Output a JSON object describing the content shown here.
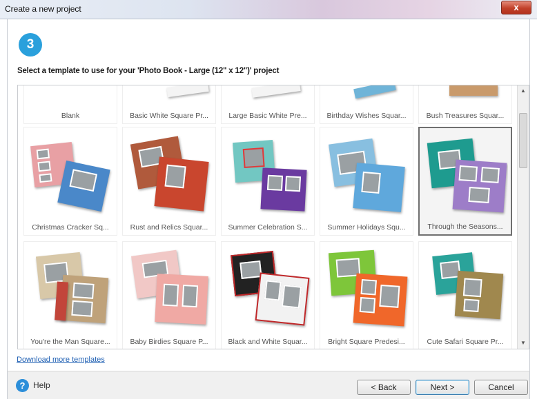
{
  "window": {
    "title": "Create a new project",
    "close_label": "x"
  },
  "step": {
    "number": "3"
  },
  "instructions": "Select a template to use for your 'Photo Book - Large (12\" x 12\")' project",
  "templates": [
    {
      "label": "Blank"
    },
    {
      "label": "Basic White Square Pr..."
    },
    {
      "label": "Large Basic White Pre..."
    },
    {
      "label": "Birthday Wishes Squar..."
    },
    {
      "label": "Bush Treasures Squar..."
    },
    {
      "label": "Christmas Cracker Sq..."
    },
    {
      "label": "Rust and Relics Squar..."
    },
    {
      "label": "Summer Celebration S..."
    },
    {
      "label": "Summer Holidays Squ..."
    },
    {
      "label": "Through the Seasons..."
    },
    {
      "label": "You're the Man Square..."
    },
    {
      "label": "Baby Birdies Square P..."
    },
    {
      "label": "Black and White Squar..."
    },
    {
      "label": "Bright Square Predesi..."
    },
    {
      "label": "Cute Safari Square Pr..."
    }
  ],
  "selected_template": "Through the Seasons...",
  "download_link": "Download more templates",
  "footer": {
    "help_label": "Help",
    "back_label": "< Back",
    "next_label": "Next >",
    "cancel_label": "Cancel"
  }
}
